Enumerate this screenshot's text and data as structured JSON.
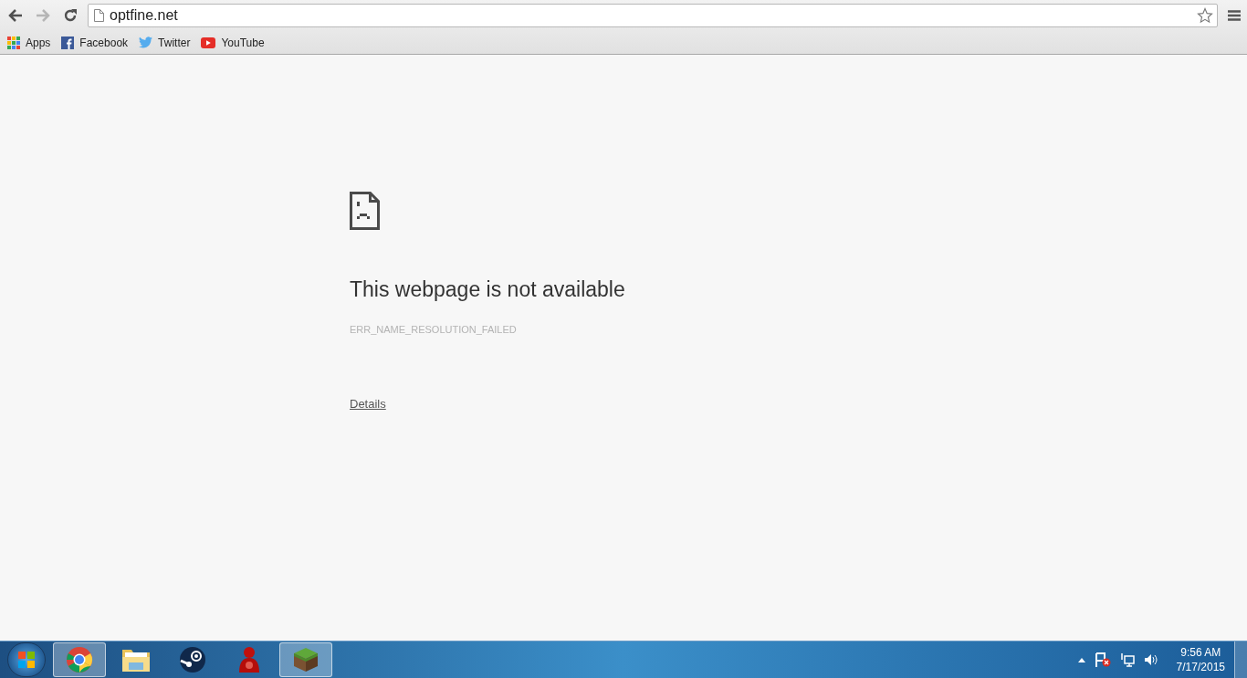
{
  "toolbar": {
    "back": {
      "disabled": false
    },
    "forward": {
      "disabled": true
    },
    "address": "optfine.net",
    "bookmarked": false
  },
  "bookmarks": [
    {
      "kind": "apps",
      "label": "Apps"
    },
    {
      "kind": "facebook",
      "label": "Facebook"
    },
    {
      "kind": "twitter",
      "label": "Twitter"
    },
    {
      "kind": "youtube",
      "label": "YouTube"
    }
  ],
  "error": {
    "title": "This webpage is not available",
    "code": "ERR_NAME_RESOLUTION_FAILED",
    "link": "Details"
  },
  "taskbar": {
    "apps": [
      {
        "kind": "chrome",
        "running": true
      },
      {
        "kind": "folder",
        "running": false
      },
      {
        "kind": "steam",
        "running": false
      },
      {
        "kind": "figure",
        "running": false
      },
      {
        "kind": "cube",
        "running": true
      }
    ],
    "time": "9:56 AM",
    "date": "7/17/2015"
  }
}
